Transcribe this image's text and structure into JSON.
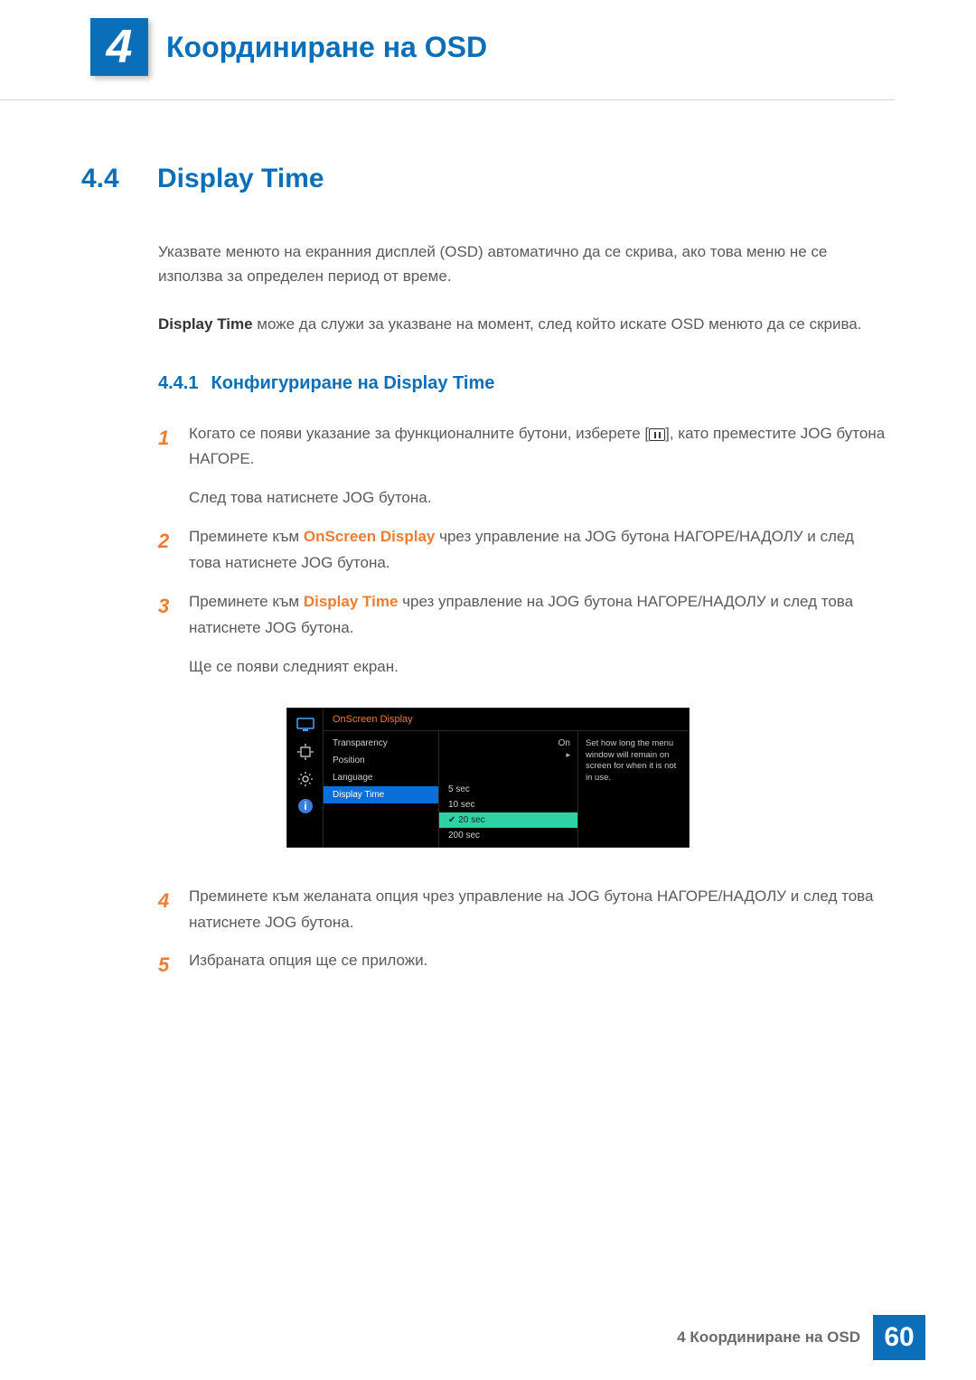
{
  "chapter": {
    "num": "4",
    "title": "Координиране на OSD"
  },
  "section": {
    "num": "4.4",
    "title": "Display Time"
  },
  "intro1": "Указвате менюто на екранния дисплей (OSD) автоматично да се скрива, ако това меню не се използва за определен период от време.",
  "intro2_bold": "Display Time",
  "intro2_rest": " може да служи за указване на момент, след който искате OSD менюто да се скрива.",
  "subsection": {
    "num": "4.4.1",
    "title": "Конфигуриране на Display Time"
  },
  "steps": {
    "s1_num": "1",
    "s1_a": "Когато се появи указание за функционалните бутони, изберете [",
    "s1_b": "], като преместите JOG бутона НАГОРЕ.",
    "s1_cont": "След това натиснете JOG бутона.",
    "s2_num": "2",
    "s2_a": "Преминете към ",
    "s2_orange": "OnScreen Display",
    "s2_b": " чрез управление на JOG бутона НАГОРЕ/НАДОЛУ и след това натиснете JOG бутона.",
    "s3_num": "3",
    "s3_a": "Преминете към ",
    "s3_orange": "Display Time",
    "s3_b": " чрез управление на JOG бутона НАГОРЕ/НАДОЛУ и след това натиснете JOG бутона.",
    "s3_cont": "Ще се появи следният екран.",
    "s4_num": "4",
    "s4": "Преминете към желаната опция чрез управление на JOG бутона НАГОРЕ/НАДОЛУ и след това натиснете JOG бутона.",
    "s5_num": "5",
    "s5": "Избраната опция ще се приложи."
  },
  "osd": {
    "title": "OnScreen Display",
    "rows": {
      "transparency": "Transparency",
      "position": "Position",
      "language": "Language",
      "displayTime": "Display Time"
    },
    "valueOn": "On",
    "arrow": "▸",
    "options": {
      "o1": "5 sec",
      "o2": "10 sec",
      "o3": "20 sec",
      "o4": "200 sec"
    },
    "help": "Set how long the menu window will remain on screen for when it is not in use."
  },
  "footer": {
    "text": "4 Координиране на OSD",
    "page": "60"
  }
}
